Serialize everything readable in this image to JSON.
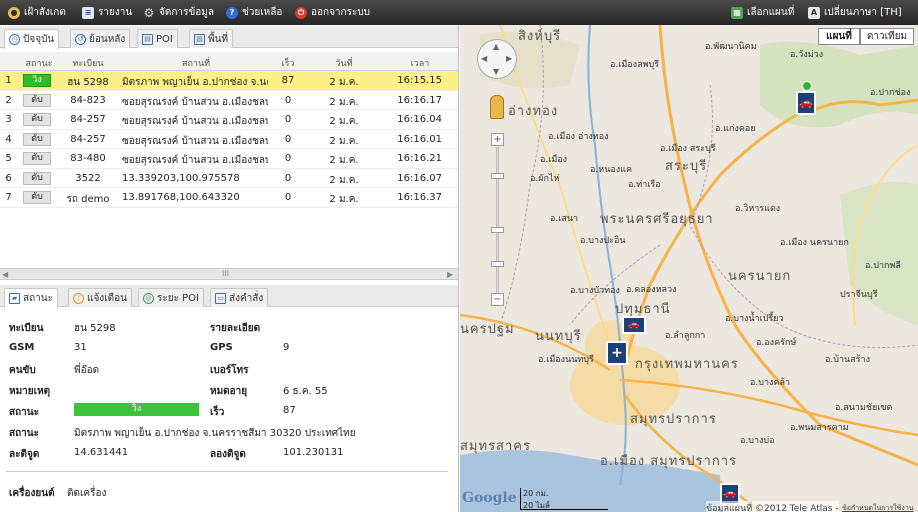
{
  "topbar": {
    "monitor": "เฝ้าสังเกต",
    "report": "รายงาน",
    "manage": "จัดการข้อมูล",
    "help": "ช่วยเหลือ",
    "logout": "ออกจากระบบ",
    "select_map": "เลือกแผนที่",
    "language": "เปลี่ยนภาษา [TH]"
  },
  "tabs_top": [
    {
      "label": "ปัจจุบัน"
    },
    {
      "label": "ย้อนหลัง"
    },
    {
      "label": "POI"
    },
    {
      "label": "พื้นที่"
    }
  ],
  "grid": {
    "headers": {
      "status": "สถานะ",
      "plate": "ทะเบียน",
      "location": "สถานที่",
      "speed": "เร็ว",
      "date": "วันที่",
      "time": "เวลา"
    },
    "rows": [
      {
        "n": "1",
        "status": "วิ่ง",
        "plate": "ฮน 5298",
        "location": "มิตรภาพ พญาเย็น อ.ปากช่อง จ.นค",
        "speed": "87",
        "date": "2 ม.ค.",
        "time": "16:15.15"
      },
      {
        "n": "2",
        "status": "ดับ",
        "plate": "84-823",
        "location": "ซอยสุรณรงค์ บ้านสวน อ.เมืองชลบุ",
        "speed": "0",
        "date": "2 ม.ค.",
        "time": "16:16.17"
      },
      {
        "n": "3",
        "status": "ดับ",
        "plate": "84-257",
        "location": "ซอยสุรณรงค์ บ้านสวน อ.เมืองชลบุ",
        "speed": "0",
        "date": "2 ม.ค.",
        "time": "16:16.04"
      },
      {
        "n": "4",
        "status": "ดับ",
        "plate": "84-257",
        "location": "ซอยสุรณรงค์ บ้านสวน อ.เมืองชลบุ",
        "speed": "0",
        "date": "2 ม.ค.",
        "time": "16:16.01"
      },
      {
        "n": "5",
        "status": "ดับ",
        "plate": "83-480",
        "location": "ซอยสุรณรงค์ บ้านสวน อ.เมืองชลบุ",
        "speed": "0",
        "date": "2 ม.ค.",
        "time": "16:16.21"
      },
      {
        "n": "6",
        "status": "ดับ",
        "plate": "3522",
        "location": "13.339203,100.975578",
        "speed": "0",
        "date": "2 ม.ค.",
        "time": "16:16.07"
      },
      {
        "n": "7",
        "status": "ดับ",
        "plate": "รถ demo",
        "location": "13.891768,100.643320",
        "speed": "0",
        "date": "2 ม.ค.",
        "time": "16:16.37"
      }
    ]
  },
  "splitter_grip": "III",
  "tabs_bottom": [
    {
      "label": "สถานะ"
    },
    {
      "label": "แจ้งเตือน"
    },
    {
      "label": "ระยะ POI"
    },
    {
      "label": "ส่งคำสั่ง"
    }
  ],
  "detail": {
    "plate_label": "ทะเบียน",
    "plate": "ฮน 5298",
    "detail_label": "รายละเอียด",
    "gsm_label": "GSM",
    "gsm": "31",
    "gps_label": "GPS",
    "gps": "9",
    "driver_label": "คนขับ",
    "driver": "พี่อ๊อด",
    "phone_label": "เบอร์โทร",
    "note_label": "หมายเหตุ",
    "expire_label": "หมดอายุ",
    "expire": "6 ธ.ค. 55",
    "status_label": "สถานะ",
    "status": "วิ่ง",
    "speed_label": "เร็ว",
    "speed": "87",
    "place_label": "สถานะ",
    "place": "มิตรภาพ พญาเย็น อ.ปากช่อง จ.นครราชสีมา 30320 ประเทศไทย",
    "lat_label": "ละติจูด",
    "lat": "14.631441",
    "lon_label": "ลองติจูด",
    "lon": "101.230131",
    "engine_label": "เครื่องยนต์",
    "engine": "ติดเครื่อง"
  },
  "map": {
    "type_map": "แผนที่",
    "type_sat": "ดาวเทียม",
    "logo": "Google",
    "scale_km": "20 กม.",
    "scale_mi": "20 ไมล์",
    "copyright": "ข้อมูลแผนที่ ©2012 Tele Atlas -",
    "terms": "ข้อกำหนดในการใช้งาน",
    "labels": {
      "sing": "สิงห์บุรี",
      "nakhon": "อ.พัฒนานิคม",
      "wangmuang": "อ.วังม่วง",
      "mueang_lop": "อ.เมืองลพบุรี",
      "angthong": "อ่างทอง",
      "pakchong": "อ.ปากช่อง",
      "muangkhaeng": "อ.แก่งคอย",
      "mueang_ang": "อ.เมือง อ่างทอง",
      "saraburi": "สระบุรี",
      "muang_sara": "อ.เมือง สระบุรี",
      "pakhai": "อ.ผักไห่",
      "ayutthaya": "พระนครศรีอยุธยา",
      "sena": "อ.เสนา",
      "bangpahan": "อ.บางปะอิน",
      "nakhonnayok": "นครนายก",
      "mueang_nny": "อ.เมือง นครนายก",
      "pathum": "ปทุมธานี",
      "nonthaburi": "นนทบุรี",
      "bangkok": "กรุงเทพมหานคร",
      "nakhonpathom": "นครปฐม",
      "samutprakan": "สมุทรปราการ",
      "samutsakhon": "สมุทรสาคร",
      "prachin": "อ.ปากพลี",
      "bangkok_bangna": "อ.บางปะกง",
      "ban_phot": "อ.บ้านโพธิ์",
      "samphran": "อ.สามพราน",
      "mueang_sp": "อ.เมือง สมุทรปราการ",
      "prachinburi": "ปราจีนบุรี",
      "bang_khla": "อ.บางคล้า",
      "sanam": "อ.สนามชัยเขต",
      "phanom": "อ.พนมสารคาม",
      "khlong": "อ.คลองหลวง",
      "lamlukka": "อ.ลำลูกกา",
      "nonthaburi_m": "อ.เมืองนนทบุรี",
      "bangbo": "อ.บางบ่อ",
      "bansang": "อ.บ้านสร้าง",
      "mueang_prachin": "อ.เมือง ปราจีนบุรี",
      "bangbuathong": "อ.บางบัวทอง",
      "wihandaeng": "อ.วิหารแดง",
      "tha_ruea": "อ.ท่าเรือ",
      "bangnamprieo": "อ.บางน้ำเปรี้ยว",
      "mueang_cc": "อ.เมือง",
      "nongkhae": "อ.หนองแค",
      "chonburi": "อ.เมือง ชลบุรี",
      "ongkharak": "อ.องครักษ์"
    }
  }
}
